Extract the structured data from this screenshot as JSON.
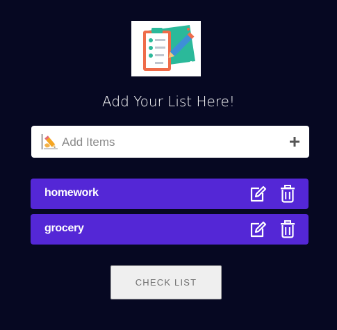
{
  "heading": "Add Your List Here!",
  "input": {
    "placeholder": "Add Items",
    "value": ""
  },
  "items": [
    {
      "label": "homework"
    },
    {
      "label": "grocery"
    }
  ],
  "check_button_label": "CHECK LIST",
  "colors": {
    "background": "#060822",
    "item_background": "#5427d6",
    "logo_teal": "#2bb99a",
    "logo_orange": "#ef6c4a"
  },
  "icons": {
    "logo": "checklist-clipboard-icon",
    "input_leading": "writing-hand-icon",
    "add": "plus-icon",
    "edit": "edit-icon",
    "delete": "trash-icon"
  }
}
